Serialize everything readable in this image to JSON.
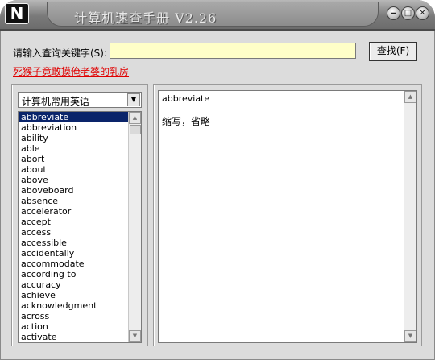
{
  "window": {
    "title": "计算机速查手册 V2.26",
    "logo": "N"
  },
  "controls": {
    "minimize": "‒",
    "maximize": "□",
    "close": "✕"
  },
  "search": {
    "label": "请输入查询关键字(S):",
    "value": "",
    "placeholder": ""
  },
  "find_button": {
    "label": "查找(F)"
  },
  "link": {
    "text": "死猴子竟敢摸俺老婆的乳房"
  },
  "category": {
    "selected": "计算机常用英语"
  },
  "words": [
    "abbreviate",
    "abbreviation",
    "ability",
    "able",
    "abort",
    "about",
    "above",
    "aboveboard",
    "absence",
    "accelerator",
    "accept",
    "access",
    "accessible",
    "accidentally",
    "accommodate",
    "according to",
    "accuracy",
    "achieve",
    "acknowledgment",
    "across",
    "action",
    "activate"
  ],
  "selected_index": 0,
  "result": {
    "word": "abbreviate",
    "definition": "缩写，省略"
  },
  "icons": {
    "dropdown": "down-triangle",
    "scroll_up": "up-triangle",
    "scroll_down": "down-triangle"
  },
  "colors": {
    "input_bg": "#ffffc8",
    "link": "#e00000",
    "selection": "#0a246a"
  }
}
